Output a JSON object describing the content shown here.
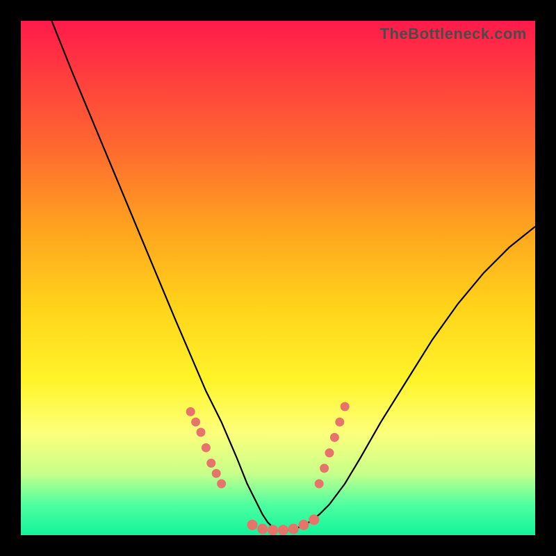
{
  "watermark": "TheBottleneck.com",
  "chart_data": {
    "type": "line",
    "title": "",
    "xlabel": "",
    "ylabel": "",
    "xlim": [
      0,
      100
    ],
    "ylim": [
      0,
      100
    ],
    "grid": false,
    "legend": false,
    "series": [
      {
        "name": "bottleneck-curve",
        "x": [
          6,
          10,
          15,
          20,
          25,
          30,
          33,
          36,
          39,
          42,
          44,
          46,
          47,
          48,
          49,
          50,
          52,
          54,
          56,
          58,
          60,
          63,
          66,
          70,
          75,
          80,
          85,
          90,
          95,
          100
        ],
        "y": [
          100,
          90,
          78,
          66,
          54,
          42,
          35,
          28,
          22,
          15,
          10,
          6,
          4,
          2.5,
          1.5,
          1,
          1,
          1.5,
          2.5,
          4,
          6,
          10,
          15,
          22,
          30,
          38,
          45,
          51,
          56,
          60
        ]
      }
    ],
    "markers": {
      "left_branch": [
        {
          "x": 33,
          "y": 24
        },
        {
          "x": 34,
          "y": 22
        },
        {
          "x": 35,
          "y": 20
        },
        {
          "x": 36,
          "y": 17
        },
        {
          "x": 37,
          "y": 14
        },
        {
          "x": 38,
          "y": 12
        },
        {
          "x": 39,
          "y": 10
        }
      ],
      "right_branch": [
        {
          "x": 58,
          "y": 10
        },
        {
          "x": 59,
          "y": 13
        },
        {
          "x": 60,
          "y": 16
        },
        {
          "x": 61,
          "y": 19
        },
        {
          "x": 62,
          "y": 22
        },
        {
          "x": 63,
          "y": 25
        }
      ],
      "bottom": [
        {
          "x": 45,
          "y": 2
        },
        {
          "x": 47,
          "y": 1.2
        },
        {
          "x": 49,
          "y": 1
        },
        {
          "x": 51,
          "y": 1
        },
        {
          "x": 53,
          "y": 1.2
        },
        {
          "x": 55,
          "y": 2
        },
        {
          "x": 57,
          "y": 3
        }
      ]
    },
    "background_gradient": [
      "#ff1a4b",
      "#ff6a2f",
      "#ffd21a",
      "#fdff7a",
      "#13f49b"
    ]
  }
}
